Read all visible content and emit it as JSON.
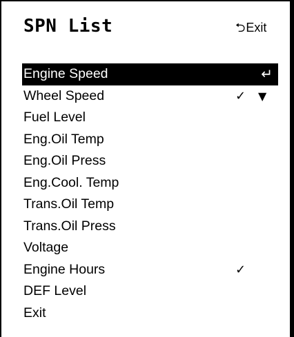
{
  "header": {
    "title": "SPN List",
    "exit_arrow": "⮌",
    "exit_label": "Exit"
  },
  "list": {
    "enter_glyph": "↵",
    "check_glyph": "✓",
    "scroll_glyph": "▼",
    "items": [
      {
        "label": "Engine Speed",
        "selected": true,
        "checked": false
      },
      {
        "label": "Wheel Speed",
        "selected": false,
        "checked": true,
        "scroll_down_indicator": true
      },
      {
        "label": "Fuel Level",
        "selected": false,
        "checked": false
      },
      {
        "label": "Eng.Oil Temp",
        "selected": false,
        "checked": false
      },
      {
        "label": "Eng.Oil Press",
        "selected": false,
        "checked": false
      },
      {
        "label": "Eng.Cool. Temp",
        "selected": false,
        "checked": false
      },
      {
        "label": "Trans.Oil Temp",
        "selected": false,
        "checked": false
      },
      {
        "label": "Trans.Oil Press",
        "selected": false,
        "checked": false
      },
      {
        "label": "Voltage",
        "selected": false,
        "checked": false
      },
      {
        "label": "Engine Hours",
        "selected": false,
        "checked": true
      },
      {
        "label": "DEF Level",
        "selected": false,
        "checked": false
      },
      {
        "label": "Exit",
        "selected": false,
        "checked": false
      }
    ]
  }
}
